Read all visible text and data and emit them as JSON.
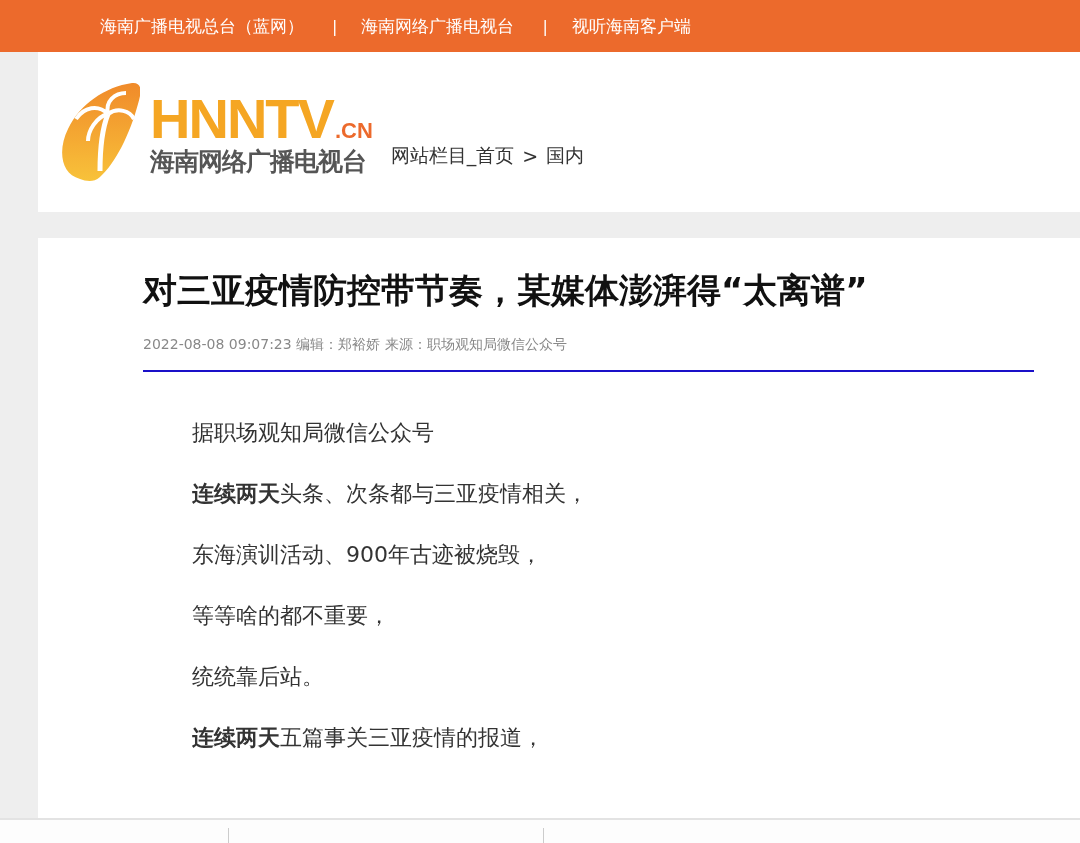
{
  "top_nav": {
    "links": [
      "海南广播电视总台（蓝网）",
      "海南网络广播电视台",
      "视听海南客户端"
    ],
    "separators": [
      "|",
      "|"
    ]
  },
  "header": {
    "logo": {
      "wordmark": "HNNTV",
      "suffix": ".CN",
      "name": "海南网络广播电视台"
    },
    "breadcrumb": [
      "网站栏目_首页",
      ">",
      "国内"
    ]
  },
  "article": {
    "title": "对三亚疫情防控带节奏，某媒体澎湃得“太离谱”",
    "meta": "2022-08-08 09:07:23 编辑：郑裕娇 来源：职场观知局微信公众号",
    "paragraphs": [
      "据职场观知局微信公众号",
      "**连续两天**头条、次条都与三亚疫情相关，",
      "东海演训活动、900年古迹被烧毁，",
      "等等啥的都不重要，",
      "统统靠后站。",
      "**连续两天**五篇事关三亚疫情的报道，"
    ]
  }
}
